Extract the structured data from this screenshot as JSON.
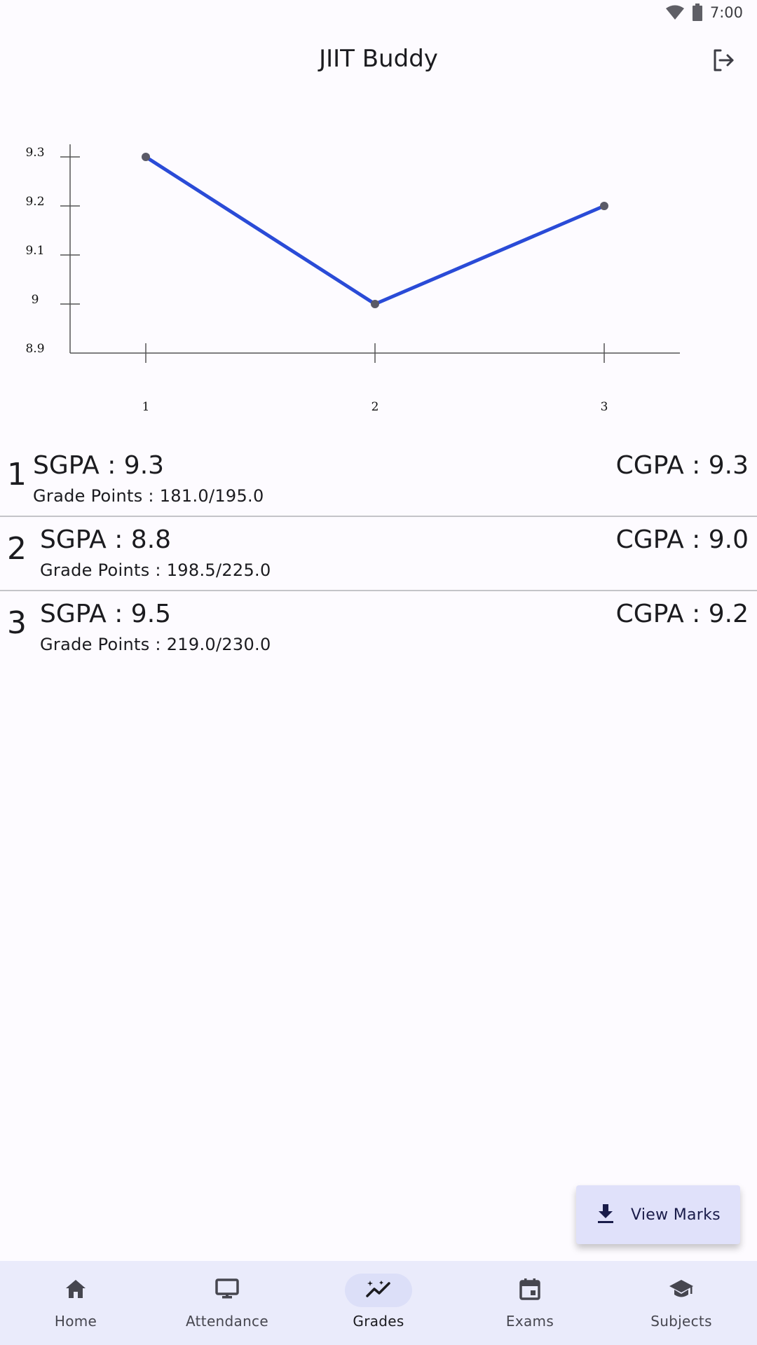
{
  "status_bar": {
    "time": "7:00"
  },
  "app_bar": {
    "title": "JIIT Buddy",
    "action_icon": "logout-icon"
  },
  "chart_data": {
    "type": "line",
    "x": [
      1,
      2,
      3
    ],
    "values": [
      9.3,
      9.0,
      9.2
    ],
    "xticks": [
      "1",
      "2",
      "3"
    ],
    "yticks": [
      "9.3",
      "9.2",
      "9.1",
      "9",
      "8.9"
    ],
    "ylim": [
      8.9,
      9.3
    ],
    "series_color": "#2a4bd7",
    "point_color": "#5a5a66",
    "grid": false
  },
  "semesters": [
    {
      "number": "1",
      "sgpa": "SGPA : 9.3",
      "grade_points": "Grade Points : 181.0/195.0",
      "cgpa": "CGPA : 9.3"
    },
    {
      "number": "2",
      "sgpa": "SGPA : 8.8",
      "grade_points": "Grade Points : 198.5/225.0",
      "cgpa": "CGPA : 9.0"
    },
    {
      "number": "3",
      "sgpa": "SGPA : 9.5",
      "grade_points": "Grade Points : 219.0/230.0",
      "cgpa": "CGPA : 9.2"
    }
  ],
  "fab": {
    "label": "View Marks",
    "icon": "download-icon"
  },
  "bottom_nav": [
    {
      "label": "Home",
      "icon": "home-icon",
      "active": false
    },
    {
      "label": "Attendance",
      "icon": "monitor-icon",
      "active": false
    },
    {
      "label": "Grades",
      "icon": "trending-icon",
      "active": true
    },
    {
      "label": "Exams",
      "icon": "calendar-icon",
      "active": false
    },
    {
      "label": "Subjects",
      "icon": "school-icon",
      "active": false
    }
  ],
  "colors": {
    "background": "#fdfbff",
    "nav_background": "#eaebfb",
    "fab_background": "#e0e1fa",
    "accent": "#2a4bd7"
  }
}
